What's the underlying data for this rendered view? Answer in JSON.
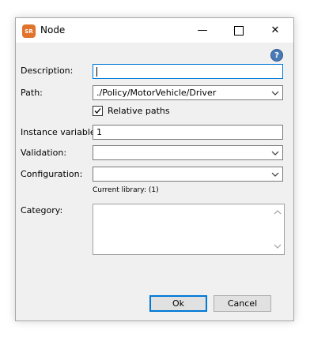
{
  "window": {
    "title": "Node",
    "app_icon_text": "SR",
    "minimize_glyph": "—",
    "close_glyph": "✕"
  },
  "help": {
    "glyph": "?"
  },
  "fields": {
    "description": {
      "label": "Description:",
      "value": ""
    },
    "path": {
      "label": "Path:",
      "value": "./Policy/MotorVehicle/Driver"
    },
    "relative_paths": {
      "label": "Relative paths",
      "checked": true
    },
    "instance_variable": {
      "label": "Instance variable:",
      "value": "1"
    },
    "validation": {
      "label": "Validation:",
      "value": ""
    },
    "configuration": {
      "label": "Configuration:",
      "value": ""
    },
    "current_library": "Current library: (1)",
    "category": {
      "label": "Category:",
      "value": ""
    }
  },
  "buttons": {
    "ok": "Ok",
    "cancel": "Cancel"
  },
  "colors": {
    "accent": "#0078d7",
    "app_icon": "#e0742d",
    "help_icon": "#4a7ab6"
  }
}
